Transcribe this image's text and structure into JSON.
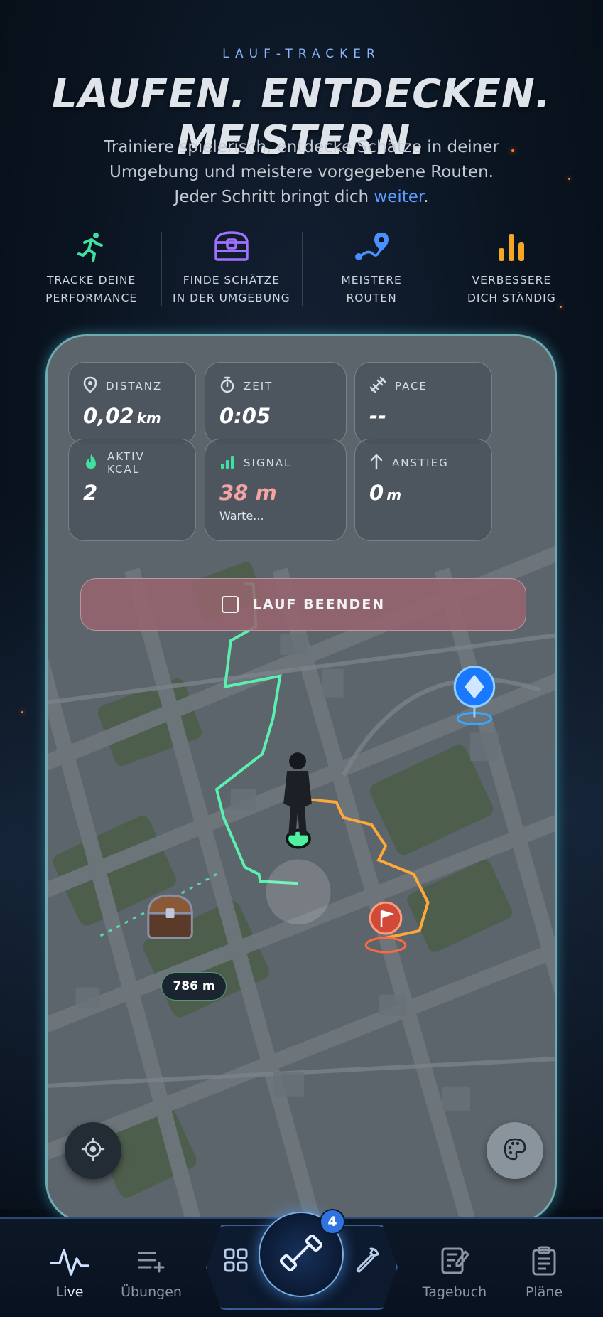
{
  "header": {
    "eyebrow": "LAUF-TRACKER",
    "headline": "LAUFEN. ENTDECKEN. MEISTERN.",
    "subtitle_line1": "Trainiere spielerisch, entdecke Schätze in deiner",
    "subtitle_line2": "Umgebung und meistere vorgegebene Routen.",
    "subtitle_line3_prefix": "Jeder Schritt bringt dich ",
    "subtitle_line3_link": "weiter",
    "subtitle_line3_suffix": "."
  },
  "features": [
    {
      "line1": "TRACKE DEINE",
      "line2": "PERFORMANCE",
      "icon": "running-icon",
      "color": "#3fe0a0"
    },
    {
      "line1": "FINDE SCHÄTZE",
      "line2": "IN DER UMGEBUNG",
      "icon": "treasure-chest-icon",
      "color": "#a070ff"
    },
    {
      "line1": "MEISTERE",
      "line2": "ROUTEN",
      "icon": "route-icon",
      "color": "#4a90ff"
    },
    {
      "line1": "VERBESSERE",
      "line2": "DICH STÄNDIG",
      "icon": "bar-chart-icon",
      "color": "#f5a623"
    }
  ],
  "stats": {
    "distance": {
      "label": "DISTANZ",
      "value": "0,02",
      "unit": "km",
      "icon": "location-pin-icon"
    },
    "time": {
      "label": "ZEIT",
      "value": "0:05",
      "icon": "stopwatch-icon"
    },
    "pace": {
      "label": "PACE",
      "value": "--",
      "icon": "pace-icon"
    },
    "kcal": {
      "label": "AKTIV KCAL",
      "value": "2",
      "icon": "flame-icon",
      "color": "#3fe0a0"
    },
    "signal": {
      "label": "SIGNAL",
      "value": "38 m",
      "note": "Warte...",
      "icon": "signal-icon",
      "color": "#3fe0a0",
      "value_color": "#f4a3a3"
    },
    "ascent": {
      "label": "ANSTIEG",
      "value": "0",
      "unit": "m",
      "icon": "arrow-up-icon"
    }
  },
  "stop_button": {
    "label": "LAUF BEENDEN"
  },
  "map": {
    "treasure_distance": "786 m"
  },
  "nav": {
    "live": "Live",
    "exercises": "Übungen",
    "journal": "Tagebuch",
    "plans": "Pläne",
    "badge_count": "4"
  },
  "colors": {
    "accent_blue": "#5b9cff",
    "trail_green": "#5cf0b0",
    "route_orange": "#ffa83a"
  }
}
